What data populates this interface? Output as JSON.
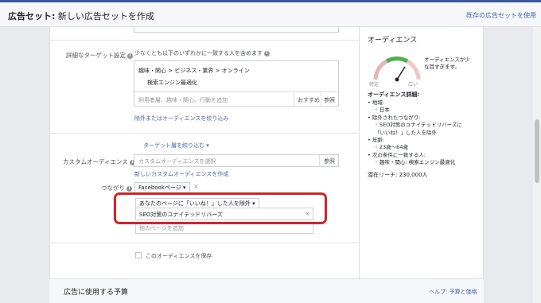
{
  "header": {
    "title_bold": "広告セット:",
    "title_rest": "新しい広告セットを作成",
    "right_link": "既存の広告セットを使用"
  },
  "detailed_targeting": {
    "label": "詳細なターゲット設定",
    "description": "少なくとも以下のいずれかに一致する人を含めます",
    "breadcrumb": "趣味・関心 > ビジネス・業界 > オンライン",
    "selected_item": "検索エンジン最適化",
    "search_placeholder": "利用者層、趣味・関心、行動を追加",
    "suggestions_button": "おすすめ",
    "browse_button": "参照",
    "exclude_link": "除外またはオーディエンスを絞り込み"
  },
  "narrow_link": "ターゲット層を絞り込む",
  "custom_audience": {
    "label": "カスタムオーディエンス",
    "placeholder": "カスタムオーディエンスを選択",
    "browse_button": "参照",
    "create_link": "新しいカスタムオーディエンスを作成"
  },
  "connections": {
    "label": "つながり",
    "dropdown": "Facebookページ",
    "rule_dropdown": "あなたのページに「いいね！」した人を除外",
    "selected_page": "SEO対策のユナイテッドリバーズ",
    "add_page_placeholder": "他のページを追加"
  },
  "save_audience": {
    "label": "このオーディエンスを保存"
  },
  "audience_panel": {
    "title": "オーディエンス",
    "gauge_note": "オーディエンスが少な目すぎます。",
    "gauge_left": "特定",
    "gauge_right": "広い",
    "details_title": "オーディエンス詳細:",
    "details": [
      {
        "type": "bul",
        "text": "地域:"
      },
      {
        "type": "sub",
        "text": "日本"
      },
      {
        "type": "bul",
        "text": "除外されたつながり:"
      },
      {
        "type": "sub",
        "text": "SEO対策のユナイテッドリバーズに「いいね！」した人を除外"
      },
      {
        "type": "bul",
        "text": "年齢:"
      },
      {
        "type": "sub",
        "text": "23歳〜64歳"
      },
      {
        "type": "bul",
        "text": "次の条件に一致する人:"
      },
      {
        "type": "sub",
        "text": "趣味・関心: 検索エンジン最適化"
      }
    ],
    "reach": "潜在リーチ: 230,000人"
  },
  "budget": {
    "title": "広告に使用する予算",
    "help_link": "ヘルプ: 予算と価格"
  }
}
